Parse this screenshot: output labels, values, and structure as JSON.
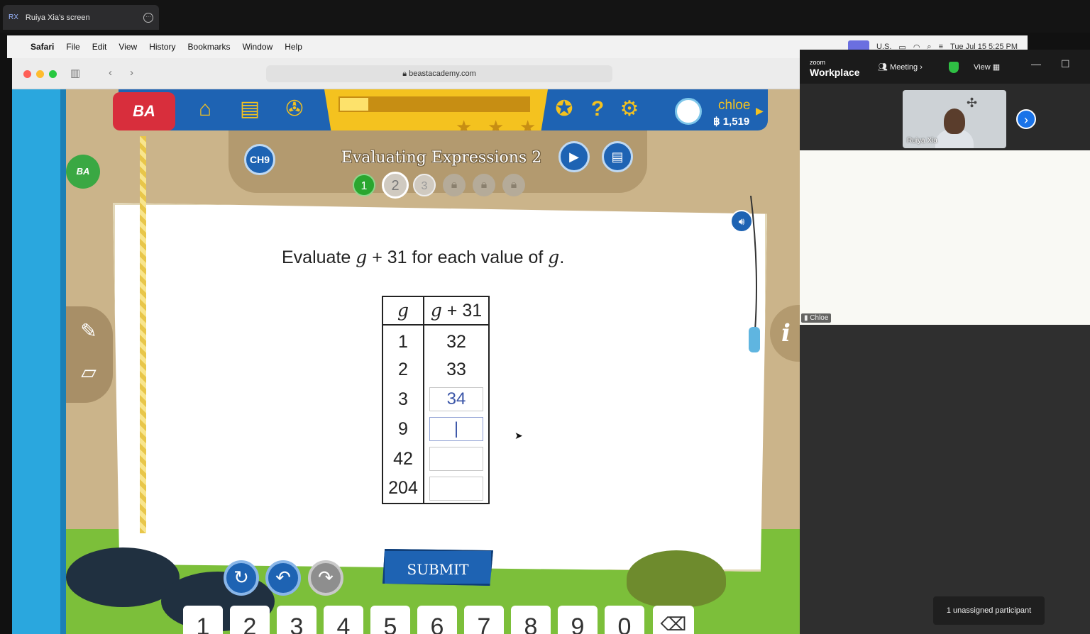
{
  "share_tab": {
    "initials": "RX",
    "title": "Ruiya Xia's screen"
  },
  "menubar": {
    "apple": "",
    "app": "Safari",
    "items": [
      "File",
      "Edit",
      "View",
      "History",
      "Bookmarks",
      "Window",
      "Help"
    ],
    "status": {
      "input": "U.S.",
      "datetime": "Tue Jul 15  5:25 PM"
    }
  },
  "browser": {
    "url": "beastacademy.com"
  },
  "game": {
    "logo": "BA",
    "side_logo": "BA",
    "user": {
      "name": "chloe",
      "coins": "฿ 1,519"
    },
    "chapter": "CH9",
    "lesson_title": "Evaluating Expressions 2",
    "steps": [
      "1",
      "2",
      "3"
    ],
    "prompt": {
      "pre": "Evaluate ",
      "var": "g",
      "mid": " + 31 for each value of ",
      "var2": "g",
      "post": "."
    },
    "table": {
      "header_g": "g",
      "header_expr_var": "g",
      "header_expr_rest": " + 31",
      "rows": [
        {
          "g": "1",
          "value": "32"
        },
        {
          "g": "2",
          "value": "33"
        },
        {
          "g": "3",
          "value": "34"
        },
        {
          "g": "9",
          "value": "|"
        },
        {
          "g": "42",
          "value": ""
        },
        {
          "g": "204",
          "value": ""
        }
      ]
    },
    "submit": "SUBMIT",
    "info": "i",
    "keypad": [
      "1",
      "2",
      "3",
      "4",
      "5",
      "6",
      "7",
      "8",
      "9",
      "0"
    ]
  },
  "zoom": {
    "logo_small": "zoom",
    "logo": "Workplace",
    "meeting": "Meeting ›",
    "view": "View",
    "thumbnail_name": "Ruiya Xia",
    "tile_name": "Chloe",
    "unassigned": "1 unassigned participant"
  },
  "colors": {
    "brand_blue": "#1e63b3",
    "brand_yellow": "#f4c21f",
    "ba_red": "#d82e3c",
    "step_green": "#2aa62f"
  }
}
